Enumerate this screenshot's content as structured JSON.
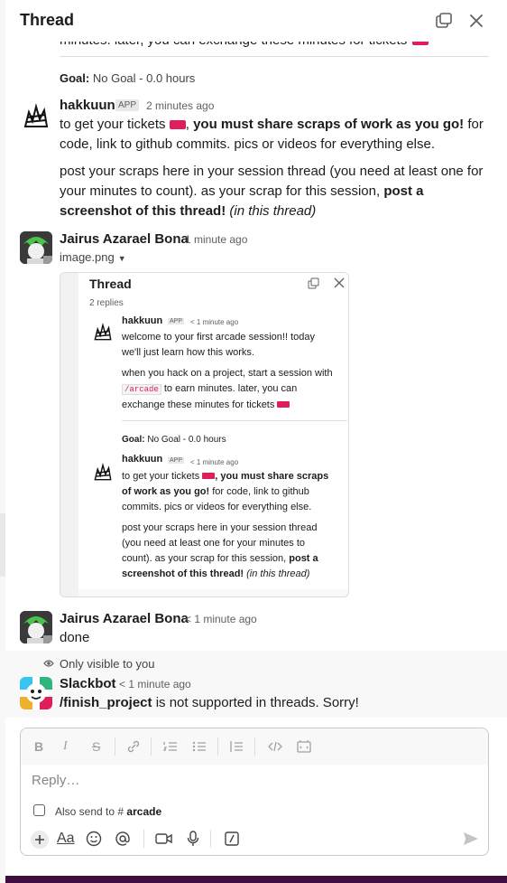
{
  "thread": {
    "title": "Thread",
    "open_window_label": "Open in new window",
    "close_label": "Close"
  },
  "quoted_message": {
    "truncated_text": "minutes. later, you can exchange these minutes for tickets",
    "goal_label": "Goal:",
    "goal_value": "No Goal - 0.0 hours"
  },
  "messages": [
    {
      "author": "hakkuun",
      "badge": "APP",
      "time": "2 minutes ago",
      "p1_a": "to get your tickets ",
      "p1_b": ", ",
      "p1_bold": "you must share scraps of work as you go!",
      "p1_c": " for code, link to github commits. pics or videos for everything else.",
      "p2_a": "post your scraps here in your session thread (you need at least one for your minutes to count). as your scrap for this session, ",
      "p2_bold": "post a screenshot of this thread!",
      "p2_italic": " (in this thread)"
    },
    {
      "author": "Jairus Azarael Bona",
      "time": "1 minute ago",
      "file_name": "image.png"
    },
    {
      "author": "Jairus Azarael Bona",
      "time": "< 1 minute ago",
      "text": "done"
    },
    {
      "visibility": "Only visible to you",
      "author": "Slackbot",
      "time": "< 1 minute ago",
      "command": "/finish_project",
      "text": " is not supported in threads. Sorry!"
    }
  ],
  "image_preview": {
    "title": "Thread",
    "replies": "2 replies",
    "msg1": {
      "author": "hakkuun",
      "badge": "APP",
      "time": "< 1 minute ago",
      "l1": "welcome to your first arcade session!! today",
      "l2": "we'll just learn how this works.",
      "l3": "when you hack on a project, start a session with",
      "code": "/arcade",
      "l4": " to earn minutes. later, you can",
      "l5": "exchange these minutes for tickets"
    },
    "goal_label": "Goal:",
    "goal_value": "No Goal - 0.0 hours",
    "msg2": {
      "author": "hakkuun",
      "badge": "APP",
      "time": "< 1 minute ago",
      "l1a": "to get your tickets ",
      "l1b": ", you must share scraps",
      "l2a": "of work as you go!",
      "l2b": " for code, link to github",
      "l3": "commits. pics or videos for everything else.",
      "l4": "post your scraps here in your session thread",
      "l5": "(you need at least one for your minutes to",
      "l6a": "count). as your scrap for this session, ",
      "l6b": "post a",
      "l7a": "screenshot of this thread!",
      "l7b": " (in this thread)"
    }
  },
  "composer": {
    "placeholder": "Reply…",
    "also_send_label": "Also send to",
    "channel_hash": "#",
    "channel": "arcade"
  },
  "colors": {
    "accent": "#e01e5a",
    "sidebar": "#3f0e40",
    "text": "#1d1c1d",
    "muted": "#616061"
  }
}
